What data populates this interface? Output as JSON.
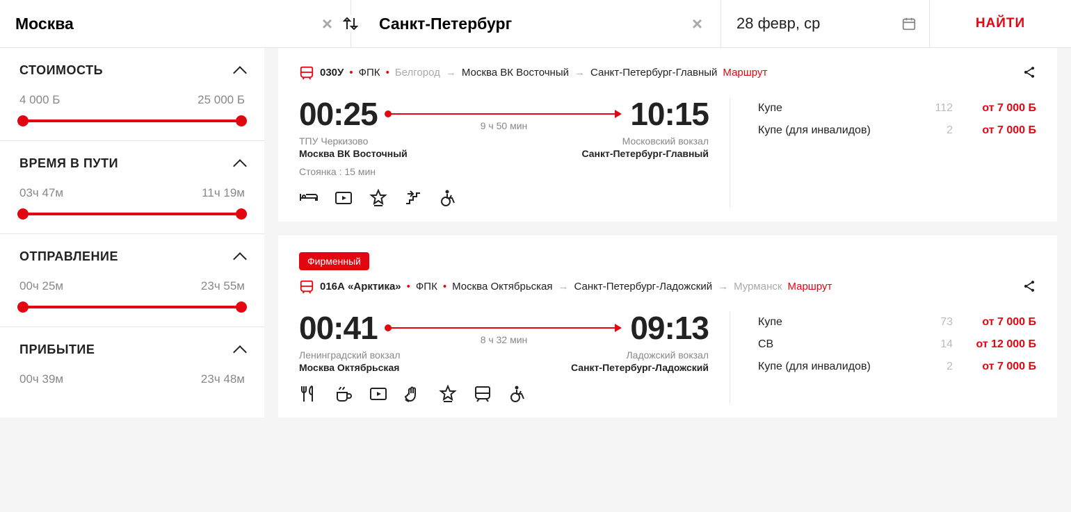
{
  "search": {
    "from": "Москва",
    "to": "Санкт-Петербург",
    "date": "28 февр, ср",
    "button": "НАЙТИ"
  },
  "filters": {
    "price": {
      "title": "СТОИМОСТЬ",
      "min": "4 000 Б",
      "max": "25 000 Б"
    },
    "duration": {
      "title": "ВРЕМЯ В ПУТИ",
      "min": "03ч 47м",
      "max": "11ч 19м"
    },
    "depart": {
      "title": "ОТПРАВЛЕНИЕ",
      "min": "00ч 25м",
      "max": "23ч 55м"
    },
    "arrive": {
      "title": "ПРИБЫТИЕ",
      "min": "00ч 39м",
      "max": "23ч 48м"
    }
  },
  "results": [
    {
      "badge": "",
      "train_no": "030У",
      "operator": "ФПК",
      "route_pre": "Белгород",
      "route_mid": "Москва ВК Восточный",
      "route_end": "Санкт-Петербург-Главный",
      "route_post": "",
      "route_link": "Маршрут",
      "dep_time": "00:25",
      "arr_time": "10:15",
      "duration": "9 ч 50 мин",
      "dep_station_sub": "ТПУ Черкизово",
      "dep_station": "Москва ВК Восточный",
      "arr_station_sub": "Московский вокзал",
      "arr_station": "Санкт-Петербург-Главный",
      "stop_note": "Стоянка : 15 мин",
      "amen_icons": [
        "bed",
        "video",
        "star",
        "stairs",
        "wheelchair"
      ],
      "fares": [
        {
          "name": "Купе",
          "count": "112",
          "price": "от 7 000 Б"
        },
        {
          "name": "Купе (для инвалидов)",
          "count": "2",
          "price": "от 7 000 Б"
        }
      ]
    },
    {
      "badge": "Фирменный",
      "train_no": "016А «Арктика»",
      "operator": "ФПК",
      "route_pre": "",
      "route_mid": "Москва Октябрьская",
      "route_end": "Санкт-Петербург-Ладожский",
      "route_post": "Мурманск",
      "route_link": "Маршрут",
      "dep_time": "00:41",
      "arr_time": "09:13",
      "duration": "8 ч 32 мин",
      "dep_station_sub": "Ленинградский вокзал",
      "dep_station": "Москва Октябрьская",
      "arr_station_sub": "Ладожский вокзал",
      "arr_station": "Санкт-Петербург-Ладожский",
      "stop_note": "",
      "amen_icons": [
        "food",
        "tea",
        "video",
        "hand",
        "star",
        "train",
        "wheelchair"
      ],
      "fares": [
        {
          "name": "Купе",
          "count": "73",
          "price": "от 7 000 Б"
        },
        {
          "name": "СВ",
          "count": "14",
          "price": "от 12 000 Б"
        },
        {
          "name": "Купе (для инвалидов)",
          "count": "2",
          "price": "от 7 000 Б"
        }
      ]
    }
  ]
}
